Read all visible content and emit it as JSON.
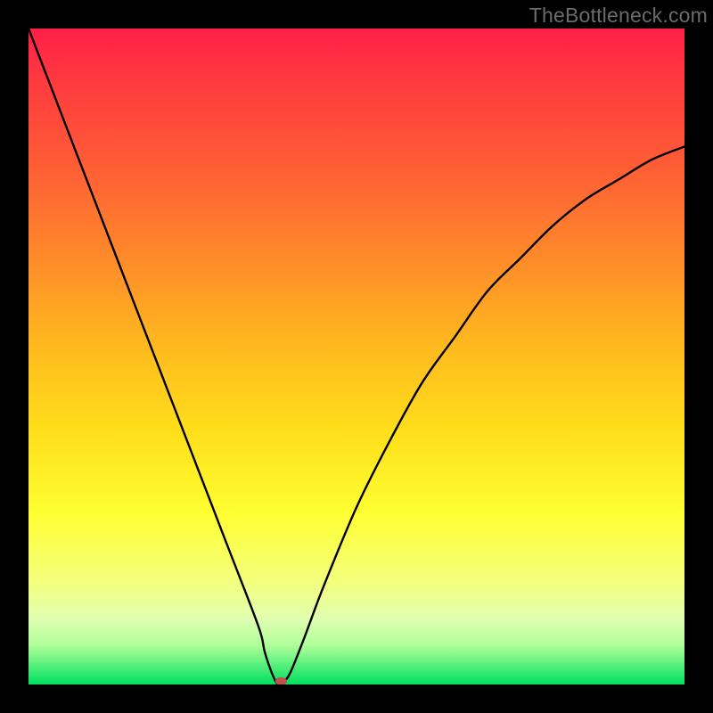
{
  "watermark": "TheBottleneck.com",
  "chart_data": {
    "type": "line",
    "title": "",
    "xlabel": "",
    "ylabel": "",
    "xlim": [
      0,
      100
    ],
    "ylim": [
      0,
      100
    ],
    "grid": false,
    "legend": false,
    "annotations": [],
    "series": [
      {
        "name": "curve",
        "color": "#000000",
        "x": [
          0,
          5,
          10,
          15,
          20,
          25,
          30,
          35,
          36,
          37,
          38,
          39,
          40,
          42,
          45,
          50,
          55,
          60,
          65,
          70,
          75,
          80,
          85,
          90,
          95,
          100
        ],
        "y": [
          100,
          87,
          74,
          61,
          48,
          35,
          22,
          9,
          5,
          2,
          0,
          0.5,
          2,
          7,
          15,
          27,
          37,
          46,
          53,
          60,
          65,
          70,
          74,
          77,
          80,
          82
        ]
      }
    ],
    "marker": {
      "x": 38.5,
      "y": 0.5,
      "color": "#c0504d",
      "rx": 0.9,
      "ry": 0.6
    }
  }
}
